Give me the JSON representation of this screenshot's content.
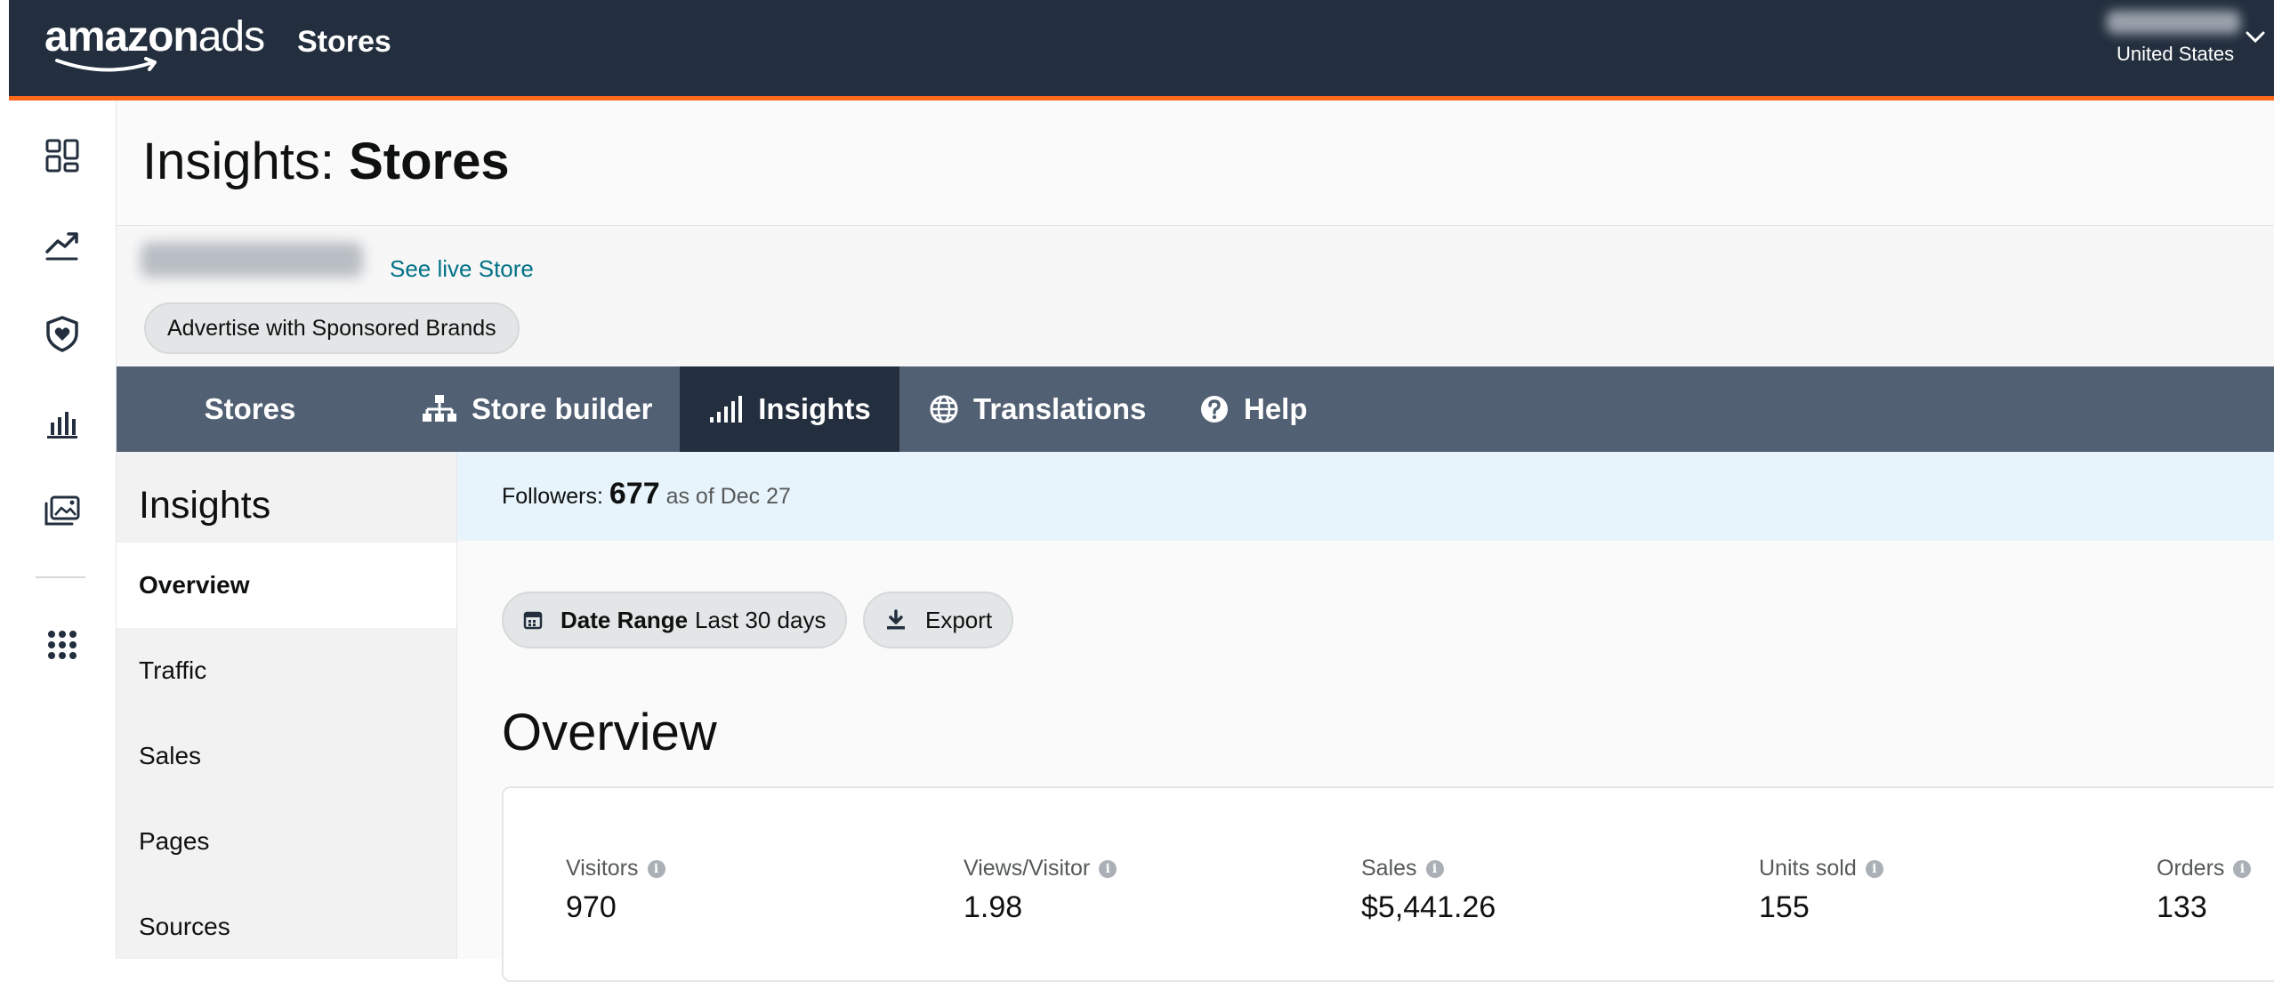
{
  "topbar": {
    "logo_text_bold": "amazon",
    "logo_text_light": "ads",
    "title": "Stores",
    "account_region": "United States"
  },
  "left_rail": {
    "icons": [
      "dashboard-icon",
      "trending-icon",
      "brand-protection-icon",
      "bar-chart-icon",
      "media-library-icon",
      "apps-grid-icon"
    ]
  },
  "header": {
    "title_prefix": "Insights:",
    "title_bold": "Stores",
    "see_live_link": "See live Store",
    "sponsored_brands_button": "Advertise with Sponsored Brands"
  },
  "tabs": [
    {
      "label": "Stores",
      "active": false
    },
    {
      "label": "Store builder",
      "icon": "sitemap-icon",
      "active": false
    },
    {
      "label": "Insights",
      "icon": "signal-bars-icon",
      "active": true
    },
    {
      "label": "Translations",
      "icon": "globe-icon",
      "active": false
    },
    {
      "label": "Help",
      "icon": "question-icon",
      "active": false
    }
  ],
  "sidenav": {
    "title": "Insights",
    "items": [
      {
        "label": "Overview",
        "active": true
      },
      {
        "label": "Traffic",
        "active": false
      },
      {
        "label": "Sales",
        "active": false
      },
      {
        "label": "Pages",
        "active": false
      },
      {
        "label": "Sources",
        "active": false
      }
    ]
  },
  "followers": {
    "label": "Followers:",
    "count": "677",
    "as_of": "as of Dec 27"
  },
  "controls": {
    "date_range_label": "Date Range",
    "date_range_value": "Last 30 days",
    "export_label": "Export"
  },
  "overview": {
    "heading": "Overview",
    "metrics": [
      {
        "label": "Visitors",
        "value": "970"
      },
      {
        "label": "Views/Visitor",
        "value": "1.98"
      },
      {
        "label": "Sales",
        "value": "$5,441.26"
      },
      {
        "label": "Units sold",
        "value": "155"
      },
      {
        "label": "Orders",
        "value": "133"
      }
    ]
  },
  "colors": {
    "topbar": "#232f3e",
    "accent": "#ff6a1a",
    "tabnav": "#526074",
    "link": "#007185",
    "followers_banner": "#e8f4fc"
  }
}
